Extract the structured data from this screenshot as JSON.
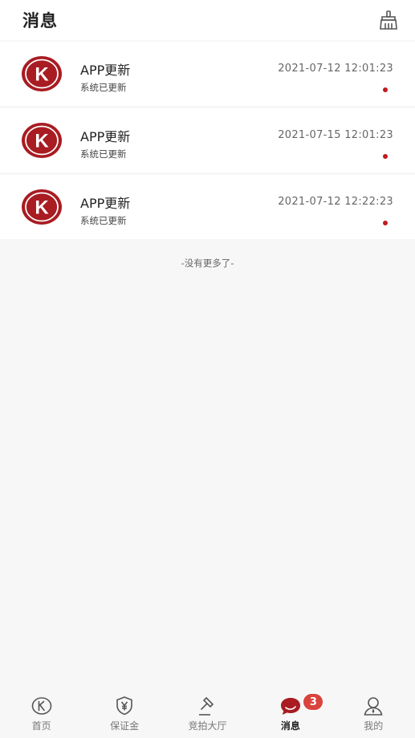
{
  "header": {
    "title": "消息"
  },
  "messages": [
    {
      "title": "APP更新",
      "subtitle": "系统已更新",
      "time": "2021-07-12 12:01:23",
      "avatar_letter": "K"
    },
    {
      "title": "APP更新",
      "subtitle": "系统已更新",
      "time": "2021-07-15 12:01:23",
      "avatar_letter": "K"
    },
    {
      "title": "APP更新",
      "subtitle": "系统已更新",
      "time": "2021-07-12 12:22:23",
      "avatar_letter": "K"
    }
  ],
  "list_end_text": "-没有更多了-",
  "tabbar": {
    "tabs": [
      {
        "label": "首页",
        "icon": "home-k-icon"
      },
      {
        "label": "保证金",
        "icon": "shield-yen-icon"
      },
      {
        "label": "竞拍大厅",
        "icon": "gavel-icon"
      },
      {
        "label": "消息",
        "icon": "chat-bubble-icon",
        "active": true,
        "badge": "3"
      },
      {
        "label": "我的",
        "icon": "user-icon"
      }
    ]
  },
  "colors": {
    "brand_red": "#a81c22",
    "badge_red": "#d9443d",
    "unread_dot": "#c01a20"
  }
}
